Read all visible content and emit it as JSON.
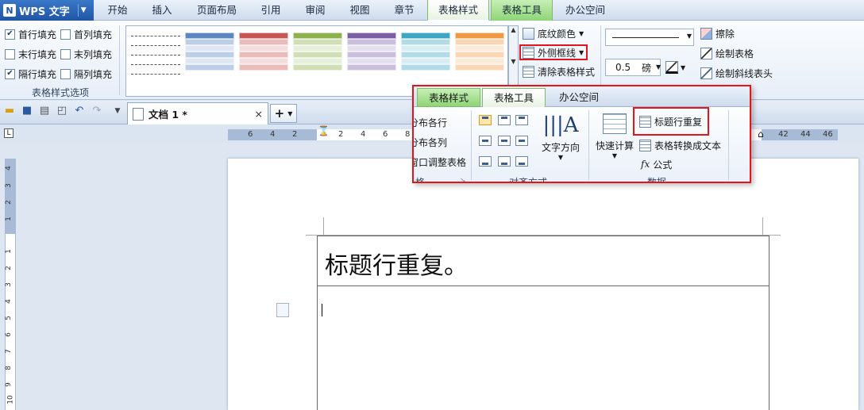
{
  "app": {
    "name": "WPS 文字",
    "logo": "N"
  },
  "tabs": [
    {
      "label": "开始"
    },
    {
      "label": "插入"
    },
    {
      "label": "页面布局"
    },
    {
      "label": "引用"
    },
    {
      "label": "审阅"
    },
    {
      "label": "视图"
    },
    {
      "label": "章节"
    },
    {
      "label": "表格样式",
      "active": true
    },
    {
      "label": "表格工具"
    },
    {
      "label": "办公空间"
    }
  ],
  "style_options": {
    "items": [
      {
        "label": "首行填充",
        "checked": true
      },
      {
        "label": "首列填充",
        "checked": false
      },
      {
        "label": "末行填充",
        "checked": false
      },
      {
        "label": "末列填充",
        "checked": false
      },
      {
        "label": "隔行填充",
        "checked": true
      },
      {
        "label": "隔列填充",
        "checked": false
      }
    ],
    "caption": "表格样式选项"
  },
  "swatch_colors": [
    "#5b86c2",
    "#c85654",
    "#8cb04c",
    "#7a5ea4",
    "#3ea6c3",
    "#ef9a43"
  ],
  "border_group": {
    "shading": "底纹颜色",
    "outer_border": "外侧框线",
    "clear_style": "清除表格样式"
  },
  "line_group": {
    "weight": "0.5",
    "unit": "磅"
  },
  "draw_group": {
    "erase": "擦除",
    "draw_table": "绘制表格",
    "draw_diagonal": "绘制斜线表头"
  },
  "quick_access": {
    "doc_title": "文档 1 *",
    "close": "×",
    "new_tab": "+"
  },
  "ruler": {
    "h_labels": [
      "6",
      "4",
      "2",
      "2",
      "4",
      "6",
      "8",
      "42",
      "44",
      "46"
    ],
    "v_labels": [
      "4",
      "3",
      "2",
      "1",
      "1",
      "2",
      "3",
      "4",
      "5",
      "6",
      "7",
      "8",
      "9",
      "10"
    ]
  },
  "document": {
    "heading_cell": "标题行重复。"
  },
  "popup": {
    "tabs": [
      {
        "label": "表格样式"
      },
      {
        "label": "表格工具",
        "active": true
      },
      {
        "label": "办公空间"
      }
    ],
    "rows_cols": {
      "distribute_rows": "分布各行",
      "distribute_cols": "分布各列",
      "autofit_window": "窗口调整表格",
      "caption_fragment": "格"
    },
    "alignment": {
      "text_direction": "文字方向",
      "caption": "对齐方式"
    },
    "data": {
      "quick_calc": "快速计算",
      "repeat_header": "标题行重复",
      "to_text": "表格转换成文本",
      "formula": "公式",
      "formula_icon": "fx",
      "caption": "数据"
    }
  }
}
